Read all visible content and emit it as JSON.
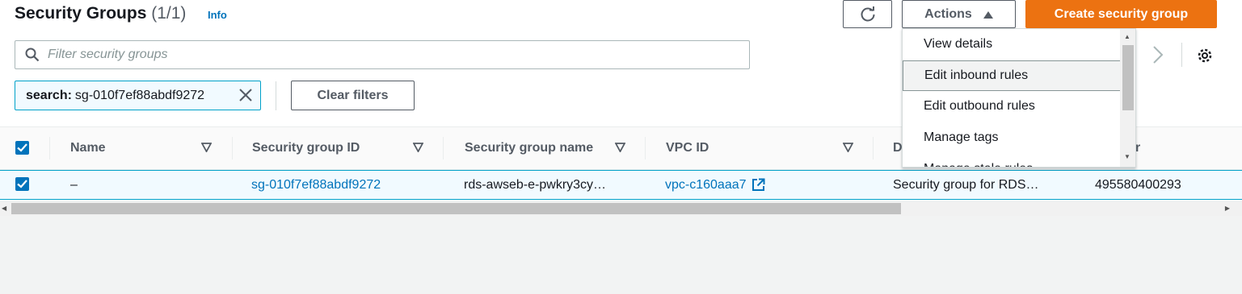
{
  "header": {
    "title": "Security Groups",
    "count": "(1/1)",
    "info_label": "Info",
    "actions_label": "Actions",
    "create_label": "Create security group"
  },
  "search": {
    "placeholder": "Filter security groups",
    "value": ""
  },
  "filter_token": {
    "key": "search:",
    "value": "sg-010f7ef88abdf9272"
  },
  "clear_filters_label": "Clear filters",
  "columns": [
    {
      "label": "Name"
    },
    {
      "label": "Security group ID"
    },
    {
      "label": "Security group name"
    },
    {
      "label": "VPC ID"
    },
    {
      "label": "D"
    },
    {
      "label": "r"
    }
  ],
  "rows": [
    {
      "name": "–",
      "sg_id": "sg-010f7ef88abdf9272",
      "sg_name": "rds-awseb-e-pwkry3cy…",
      "vpc_id": "vpc-c160aaa7",
      "description": "Security group for RDS…",
      "owner": "495580400293"
    }
  ],
  "actions_menu": {
    "items": [
      {
        "label": "View details"
      },
      {
        "label": "Edit inbound rules"
      },
      {
        "label": "Edit outbound rules"
      },
      {
        "label": "Manage tags"
      },
      {
        "label": "Manage stale rules"
      }
    ],
    "highlighted_index": 1
  },
  "colors": {
    "accent": "#0073bb",
    "primary_button": "#ec7211",
    "selection_bg": "#f1faff",
    "selection_border": "#00a1c9"
  },
  "icons": {
    "refresh": "refresh-icon",
    "caret": "caret-up-icon",
    "search": "search-icon",
    "close": "close-icon",
    "sort": "sort-down-icon",
    "external": "external-link-icon",
    "next": "chevron-right-icon",
    "settings": "gear-icon"
  }
}
